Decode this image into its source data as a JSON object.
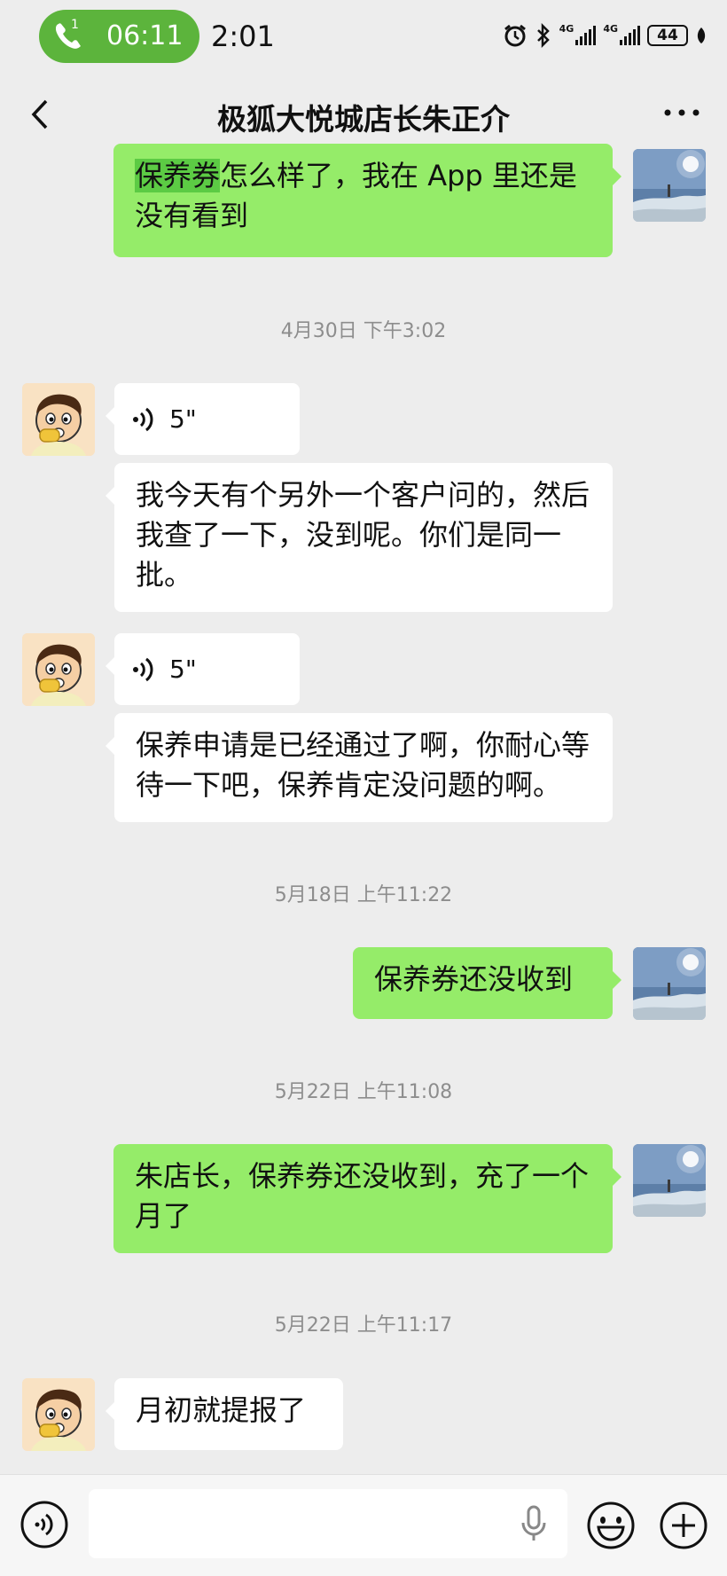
{
  "status_bar": {
    "call_badge": "1",
    "call_timer": "06:11",
    "clock": "2:01",
    "network1": "4G",
    "network2": "4G",
    "battery": "44"
  },
  "header": {
    "title": "极狐大悦城店长朱正介"
  },
  "messages": [
    {
      "type": "text",
      "side": "out",
      "highlight": "保养券",
      "text": "怎么样了，我在 App 里还是没有看到"
    },
    {
      "type": "time",
      "text": "4月30日 下午3:02"
    },
    {
      "type": "voice",
      "side": "in",
      "duration": "5\""
    },
    {
      "type": "text",
      "side": "in",
      "text": "我今天有个另外一个客户问的，然后我查了一下，没到呢。你们是同一批。"
    },
    {
      "type": "voice",
      "side": "in",
      "duration": "5\""
    },
    {
      "type": "text",
      "side": "in",
      "text": "保养申请是已经通过了啊，你耐心等待一下吧，保养肯定没问题的啊。"
    },
    {
      "type": "time",
      "text": "5月18日 上午11:22"
    },
    {
      "type": "text",
      "side": "out",
      "text": "保养券还没收到"
    },
    {
      "type": "time",
      "text": "5月22日 上午11:08"
    },
    {
      "type": "text",
      "side": "out",
      "text": "朱店长，保养券还没收到，充了一个月了"
    },
    {
      "type": "time",
      "text": "5月22日 上午11:17"
    },
    {
      "type": "text",
      "side": "in",
      "text": "月初就提报了"
    }
  ],
  "icons": {
    "back": "back-arrow-icon",
    "more": "more-icon",
    "voice_mode": "voice-mode-icon",
    "mic": "microphone-icon",
    "emoji": "emoji-icon",
    "plus": "plus-icon"
  },
  "colors": {
    "background": "#ededed",
    "outgoing_bubble": "#95ec69",
    "incoming_bubble": "#ffffff",
    "call_pill": "#5cb43c",
    "highlight": "#5ccb44",
    "timestamp": "#8d8d8d"
  }
}
